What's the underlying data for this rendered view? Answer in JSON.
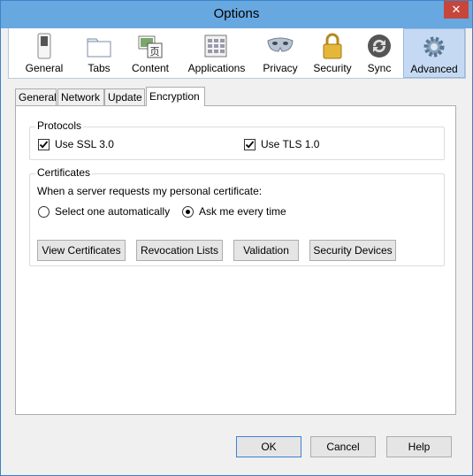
{
  "window": {
    "title": "Options",
    "close_glyph": "✕"
  },
  "toolbar": {
    "items": [
      {
        "label": "General",
        "icon": "switch-icon"
      },
      {
        "label": "Tabs",
        "icon": "tabs-icon"
      },
      {
        "label": "Content",
        "icon": "content-icon"
      },
      {
        "label": "Applications",
        "icon": "applications-icon"
      },
      {
        "label": "Privacy",
        "icon": "mask-icon"
      },
      {
        "label": "Security",
        "icon": "lock-icon"
      },
      {
        "label": "Sync",
        "icon": "sync-icon"
      },
      {
        "label": "Advanced",
        "icon": "gear-icon"
      }
    ],
    "selected": "Advanced"
  },
  "subtabs": {
    "items": [
      "General",
      "Network",
      "Update",
      "Encryption"
    ],
    "active": "Encryption"
  },
  "protocols": {
    "legend": "Protocols",
    "ssl": {
      "label": "Use SSL 3.0",
      "checked": true
    },
    "tls": {
      "label": "Use TLS 1.0",
      "checked": true
    }
  },
  "certificates": {
    "legend": "Certificates",
    "prompt": "When a server requests my personal certificate:",
    "options": [
      {
        "label": "Select one automatically",
        "selected": false
      },
      {
        "label": "Ask me every time",
        "selected": true
      }
    ],
    "buttons": [
      "View Certificates",
      "Revocation Lists",
      "Validation",
      "Security Devices"
    ]
  },
  "footer": {
    "ok": "OK",
    "cancel": "Cancel",
    "help": "Help"
  },
  "colors": {
    "titlebar": "#67a8e0",
    "selected_tool": "#c5daf2",
    "close": "#c7463b"
  }
}
